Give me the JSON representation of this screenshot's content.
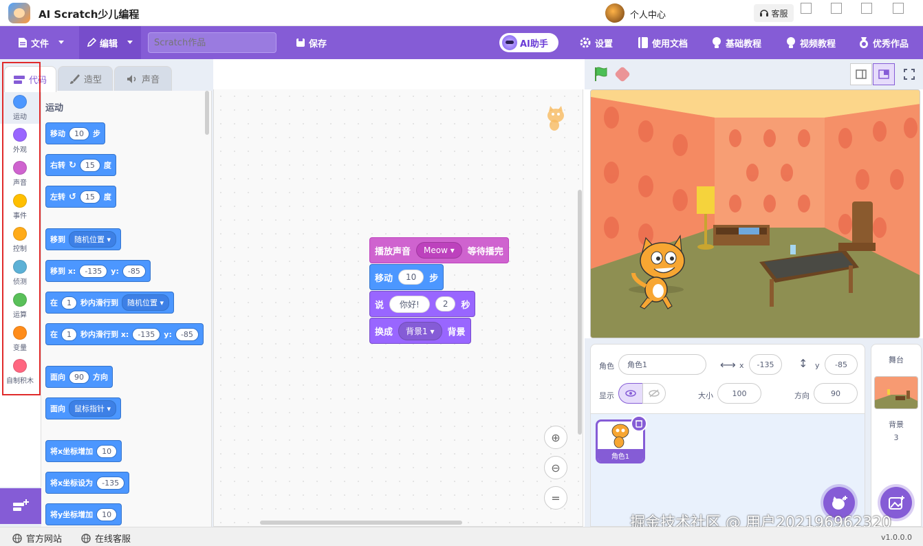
{
  "app": {
    "title": "AI Scratch少儿编程",
    "user_center": "个人中心",
    "support": "客服"
  },
  "menu": {
    "file": "文件",
    "edit": "编辑",
    "project_placeholder": "Scratch作品",
    "save": "保存",
    "ai_assistant": "AI助手",
    "settings": "设置",
    "docs": "使用文档",
    "basic_tutorial": "基础教程",
    "video_tutorial": "视频教程",
    "showcase": "优秀作品"
  },
  "tabs": {
    "code": "代码",
    "costume": "造型",
    "sound": "声音"
  },
  "categories": [
    {
      "label": "运动",
      "color": "#4c97ff"
    },
    {
      "label": "外观",
      "color": "#9966ff"
    },
    {
      "label": "声音",
      "color": "#cf63cf"
    },
    {
      "label": "事件",
      "color": "#ffbf00"
    },
    {
      "label": "控制",
      "color": "#ffab19"
    },
    {
      "label": "侦测",
      "color": "#5cb1d6"
    },
    {
      "label": "运算",
      "color": "#59c059"
    },
    {
      "label": "变量",
      "color": "#ff8c1a"
    },
    {
      "label": "自制积木",
      "color": "#ff6680"
    }
  ],
  "palette": {
    "heading": "运动",
    "move": {
      "a": "移动",
      "v": "10",
      "b": "步"
    },
    "turn_right": {
      "a": "右转",
      "v": "15",
      "b": "度"
    },
    "turn_left": {
      "a": "左转",
      "v": "15",
      "b": "度"
    },
    "goto": {
      "a": "移到",
      "dd": "随机位置"
    },
    "goto_xy": {
      "a": "移到 x:",
      "x": "-135",
      "yl": "y:",
      "y": "-85"
    },
    "glide": {
      "a": "在",
      "v": "1",
      "b": "秒内滑行到",
      "dd": "随机位置"
    },
    "glide_xy": {
      "a": "在",
      "v": "1",
      "b": "秒内滑行到 x:",
      "x": "-135",
      "yl": "y:",
      "y": "-85"
    },
    "point_dir": {
      "a": "面向",
      "v": "90",
      "b": "方向"
    },
    "point_towards": {
      "a": "面向",
      "dd": "鼠标指针"
    },
    "change_x": {
      "a": "将x坐标增加",
      "v": "10"
    },
    "set_x": {
      "a": "将x坐标设为",
      "v": "-135"
    },
    "change_y": {
      "a": "将y坐标增加",
      "v": "10"
    }
  },
  "script": {
    "play_sound": {
      "a": "播放声音",
      "dd": "Meow",
      "b": "等待播完"
    },
    "move": {
      "a": "移动",
      "v": "10",
      "b": "步"
    },
    "say": {
      "a": "说",
      "v": "你好!",
      "v2": "2",
      "b": "秒"
    },
    "switch_backdrop": {
      "a": "换成",
      "dd": "背景1",
      "b": "背景"
    }
  },
  "sprite": {
    "label_sprite": "角色",
    "name": "角色1",
    "label_x": "x",
    "x": "-135",
    "label_y": "y",
    "y": "-85",
    "label_show": "显示",
    "label_size": "大小",
    "size": "100",
    "label_direction": "方向",
    "direction": "90",
    "tile_name": "角色1"
  },
  "stage_panel": {
    "title": "舞台",
    "backdrop_label": "背景",
    "backdrop_count": "3"
  },
  "status": {
    "website": "官方网站",
    "online_support": "在线客服",
    "version": "v1.0.0.0"
  },
  "watermark": "掘金技术社区 @ 用户2021969623​20",
  "colors": {
    "accent": "#855cd6",
    "motion": "#4c97ff",
    "sound": "#cf63cf",
    "looks": "#9966ff",
    "highlight": "#e02a2a"
  }
}
